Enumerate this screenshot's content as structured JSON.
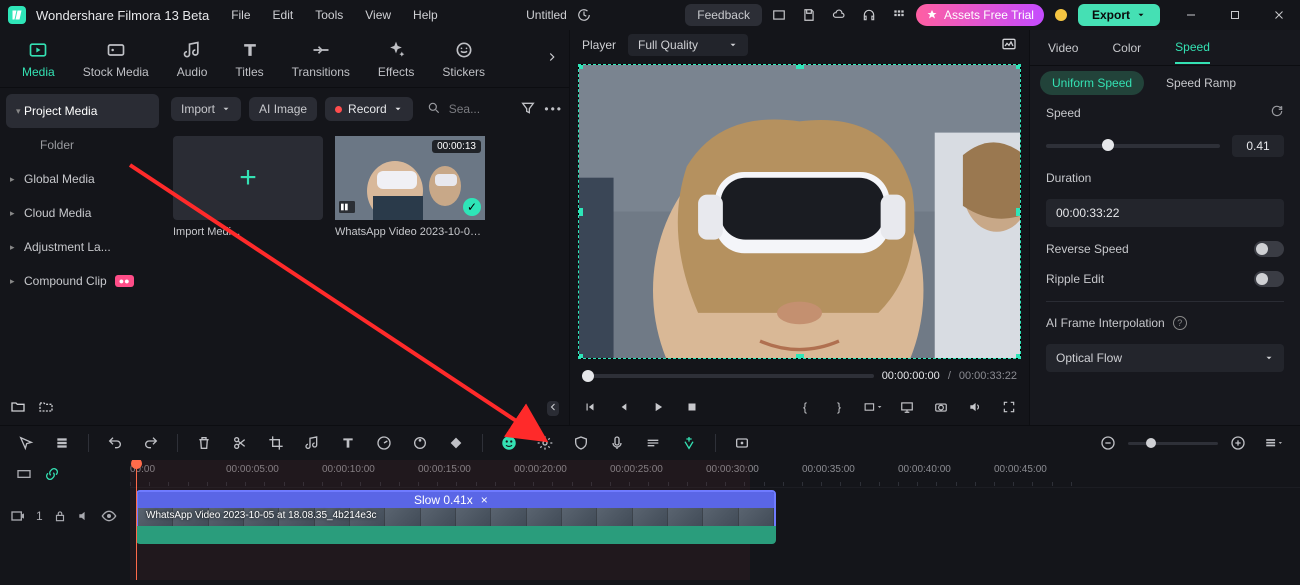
{
  "app": {
    "name": "Wondershare Filmora 13 Beta",
    "doc": "Untitled"
  },
  "menus": [
    "File",
    "Edit",
    "Tools",
    "View",
    "Help"
  ],
  "title_actions": {
    "feedback": "Feedback",
    "assets": "Assets Free Trial",
    "export": "Export"
  },
  "top_tabs": [
    {
      "id": "media",
      "label": "Media",
      "active": true
    },
    {
      "id": "stock",
      "label": "Stock Media"
    },
    {
      "id": "audio",
      "label": "Audio"
    },
    {
      "id": "titles",
      "label": "Titles"
    },
    {
      "id": "transitions",
      "label": "Transitions"
    },
    {
      "id": "effects",
      "label": "Effects"
    },
    {
      "id": "stickers",
      "label": "Stickers"
    }
  ],
  "sidebar": {
    "items": [
      {
        "label": "Project Media",
        "active": true
      },
      {
        "label": "Folder",
        "child": true
      },
      {
        "label": "Global Media"
      },
      {
        "label": "Cloud Media"
      },
      {
        "label": "Adjustment La..."
      },
      {
        "label": "Compound Clip",
        "badge": true
      }
    ]
  },
  "media_toolbar": {
    "import": "Import",
    "ai_image": "AI Image",
    "record": "Record",
    "search_placeholder": "Sea..."
  },
  "media_cards": [
    {
      "label": "Import Medi..."
    },
    {
      "label": "WhatsApp Video 2023-10-05...",
      "duration": "00:00:13",
      "checked": true
    }
  ],
  "player": {
    "title": "Player",
    "quality": "Full Quality",
    "tc_current": "00:00:00:00",
    "tc_total": "00:00:33:22"
  },
  "right": {
    "tabs": [
      "Video",
      "Color",
      "Speed"
    ],
    "active_tab": "Speed",
    "subtabs": [
      "Uniform Speed",
      "Speed Ramp"
    ],
    "active_sub": "Uniform Speed",
    "speed_label": "Speed",
    "speed_value": "0.41",
    "duration_label": "Duration",
    "duration_value": "00:00:33:22",
    "reverse_label": "Reverse Speed",
    "ripple_label": "Ripple Edit",
    "ai_label": "AI Frame Interpolation",
    "ai_value": "Optical Flow"
  },
  "timeline": {
    "ticks": [
      "00:00",
      "00:00:05:00",
      "00:00:10:00",
      "00:00:15:00",
      "00:00:20:00",
      "00:00:25:00",
      "00:00:30:00",
      "00:00:35:00",
      "00:00:40:00",
      "00:00:45:00"
    ],
    "clip_header": "Slow 0.41x",
    "clip_label": "WhatsApp Video 2023-10-05 at 18.08.35_4b214e3c",
    "track_num": "1"
  }
}
